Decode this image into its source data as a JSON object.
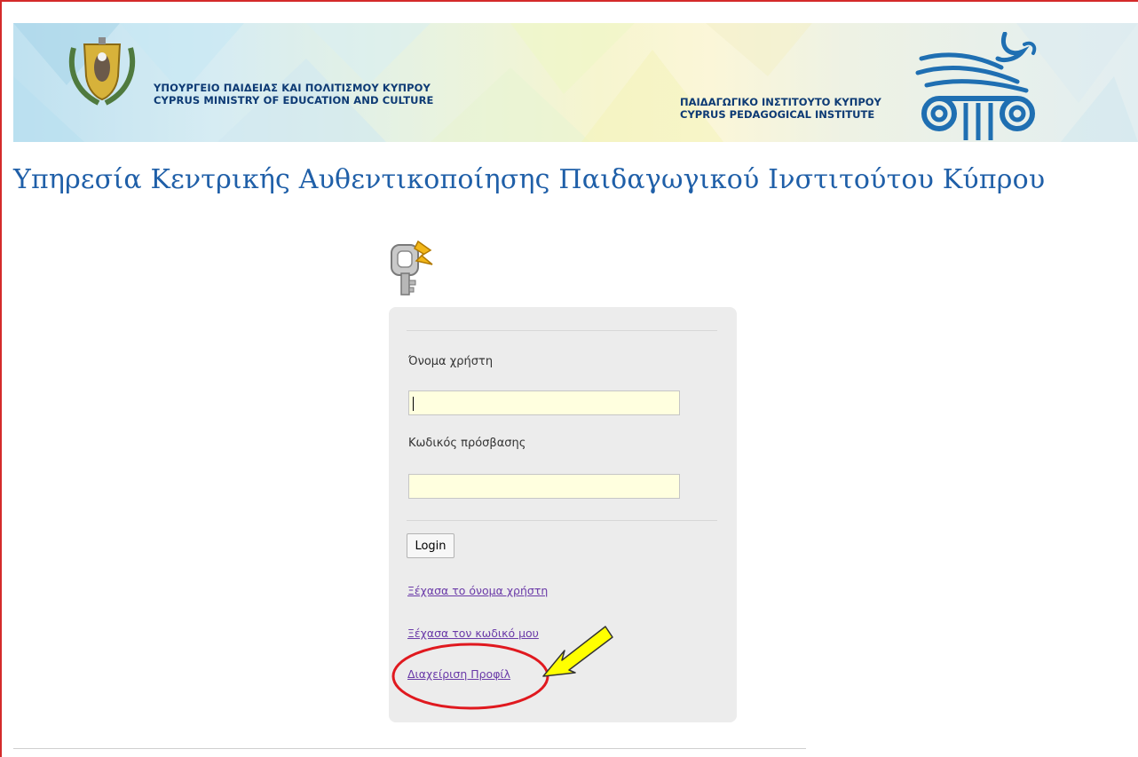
{
  "banner": {
    "ministry_line1": "ΥΠΟΥΡΓΕΙΟ ΠΑΙΔΕΙΑΣ ΚΑΙ ΠΟΛΙΤΙΣΜΟΥ ΚΥΠΡΟΥ",
    "ministry_line2": "CYPRUS MINISTRY OF EDUCATION AND CULTURE",
    "institute_line1": "ΠΑΙΔΑΓΩΓΙΚΟ ΙΝΣΤΙΤΟΥΤΟ ΚΥΠΡΟΥ",
    "institute_line2": "CYPRUS PEDAGOGICAL INSTITUTE"
  },
  "page": {
    "title": "Υπηρεσία Κεντρικής Αυθεντικοποίησης Παιδαγωγικού Ινστιτούτου Κύπρου"
  },
  "login": {
    "username_label": "Όνομα χρήστη",
    "username_value": "",
    "password_label": "Κωδικός πρόσβασης",
    "password_value": "",
    "login_button": "Login",
    "forgot_username": "Ξέχασα το όνομα χρήστη",
    "forgot_password": "Ξέχασα τον κωδικό μου",
    "profile_management": "Διαχείριση Προφίλ"
  },
  "colors": {
    "title": "#1f5fa8",
    "link": "#6a3aa8",
    "field_bg": "#ffffdf",
    "annotation_circle": "#e0191f",
    "annotation_arrow": "#ffff00"
  },
  "icons": {
    "key": "key-icon",
    "crest": "cyprus-crest-icon",
    "institute_logo": "ionic-column-logo-icon"
  }
}
